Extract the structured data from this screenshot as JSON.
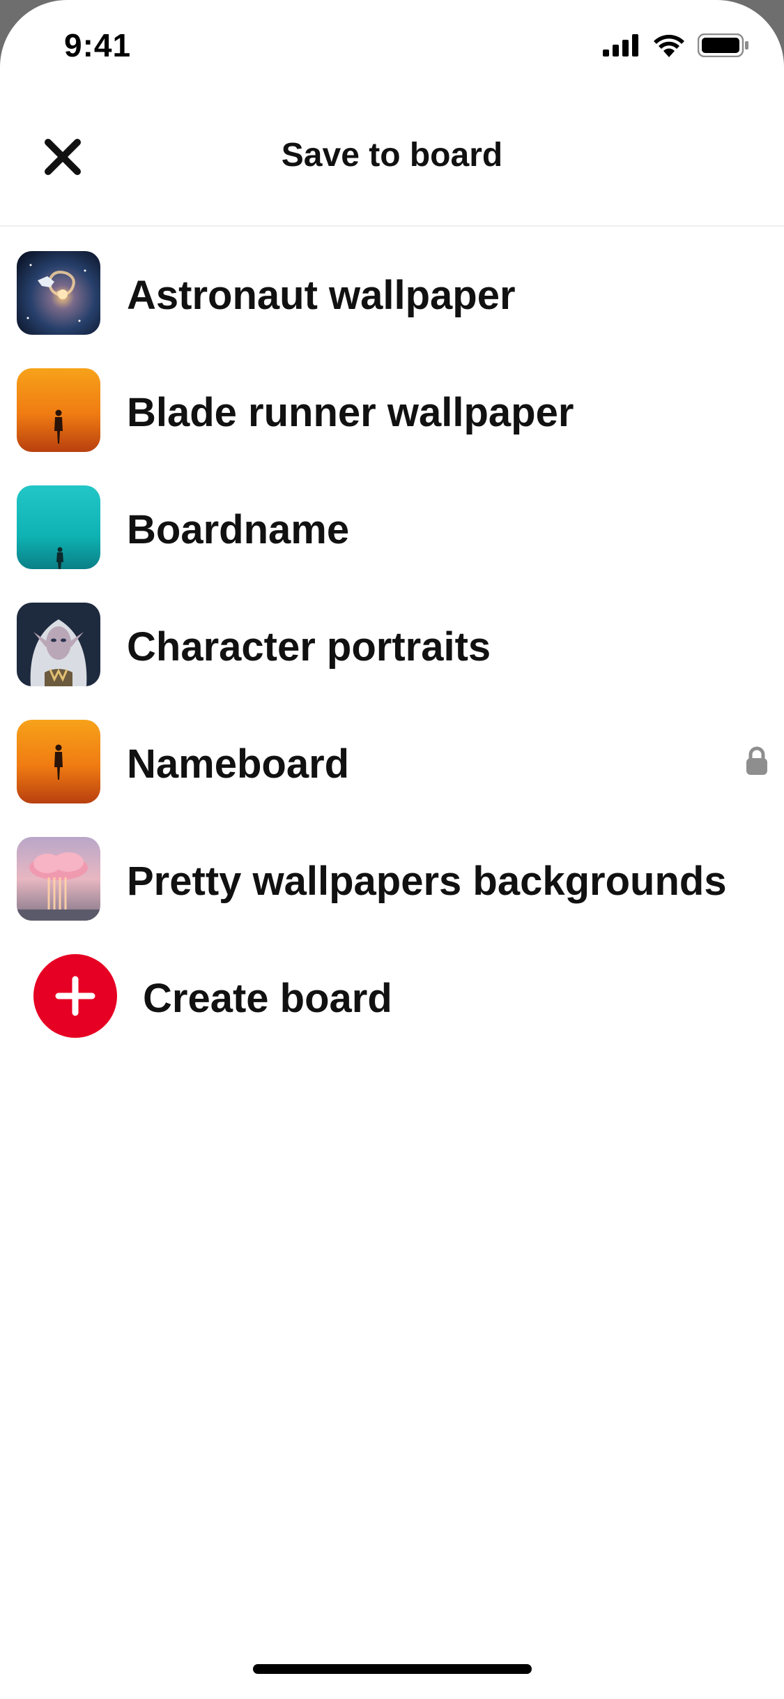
{
  "status_bar": {
    "time": "9:41"
  },
  "header": {
    "title": "Save to board",
    "close_icon": "close-icon"
  },
  "boards": [
    {
      "name": "Astronaut wallpaper",
      "thumbnail": "galaxy-astronaut",
      "locked": false
    },
    {
      "name": "Blade runner wallpaper",
      "thumbnail": "orange-figure",
      "locked": false
    },
    {
      "name": "Boardname",
      "thumbnail": "teal-figure",
      "locked": false
    },
    {
      "name": "Character portraits",
      "thumbnail": "elf-portrait",
      "locked": false
    },
    {
      "name": "Nameboard",
      "thumbnail": "orange-figure",
      "locked": true
    },
    {
      "name": "Pretty wallpapers backgrounds",
      "thumbnail": "pink-cloud",
      "locked": false
    }
  ],
  "create_board": {
    "label": "Create board",
    "icon": "plus-icon",
    "color": "#e60023"
  },
  "colors": {
    "accent": "#e60023",
    "text": "#111111",
    "lock": "#8e8e8e"
  }
}
